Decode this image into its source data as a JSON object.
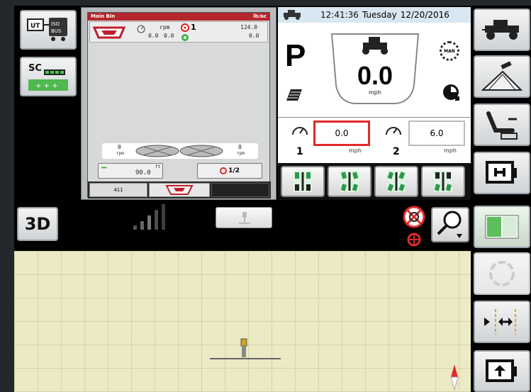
{
  "header": {
    "time": "12:41:36",
    "day": "Tuesday",
    "date": "12/20/2016"
  },
  "left_panel": {
    "ut_button_label": "UT",
    "isobus_label": "ISO BUS",
    "sc_label": "SC",
    "view_3d_label": "3D"
  },
  "rate_controller": {
    "title": "Main Bin",
    "rate_unit": "lb/ac",
    "rpm_label": "rpm",
    "rpm_value": "0.0",
    "zero_value": "0.0",
    "section_num": "1",
    "target_rate": "124.0",
    "actual_rate": "0.0",
    "left_spinner_value": "0",
    "left_spinner_unit": "rpm",
    "right_spinner_value": "0",
    "right_spinner_unit": "rpm",
    "bin_value": "90.0",
    "bin_sub": "ft",
    "section_toggle": "1/2",
    "tab_1": "411"
  },
  "speed": {
    "gear": "P",
    "value": "0.0",
    "unit": "mph",
    "man_label": "MAN",
    "set1_value": "0.0",
    "set1_num": "1",
    "set1_unit": "mph",
    "set2_value": "6.0",
    "set2_num": "2",
    "set2_unit": "mph"
  },
  "colors": {
    "accent_red": "#e02a2a",
    "header_blue": "#d8e7f2",
    "map_bg": "#eceac5",
    "panel_grey": "#b9bcbf"
  }
}
